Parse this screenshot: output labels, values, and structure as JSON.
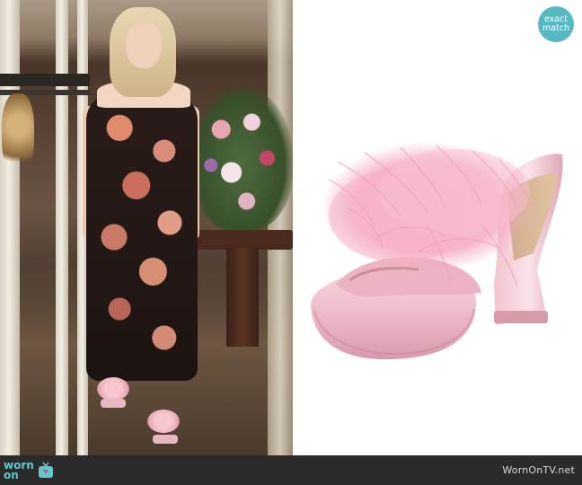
{
  "badge": {
    "line1": "exact",
    "line2": "match",
    "color": "#57b9c1"
  },
  "left_image": {
    "icon": "scene-photo"
  },
  "right_image": {
    "icon": "pink-feather-platform-mule-photo",
    "shoe_color": "#eebbc8",
    "feather_color": "#f3a9bf"
  },
  "footer": {
    "background": "#2b2b2b",
    "logo_line1": "worn",
    "logo_line2": "on",
    "logo_icon": "tv-icon",
    "accent": "#62c6cf",
    "site": "WornOnTV.net"
  }
}
